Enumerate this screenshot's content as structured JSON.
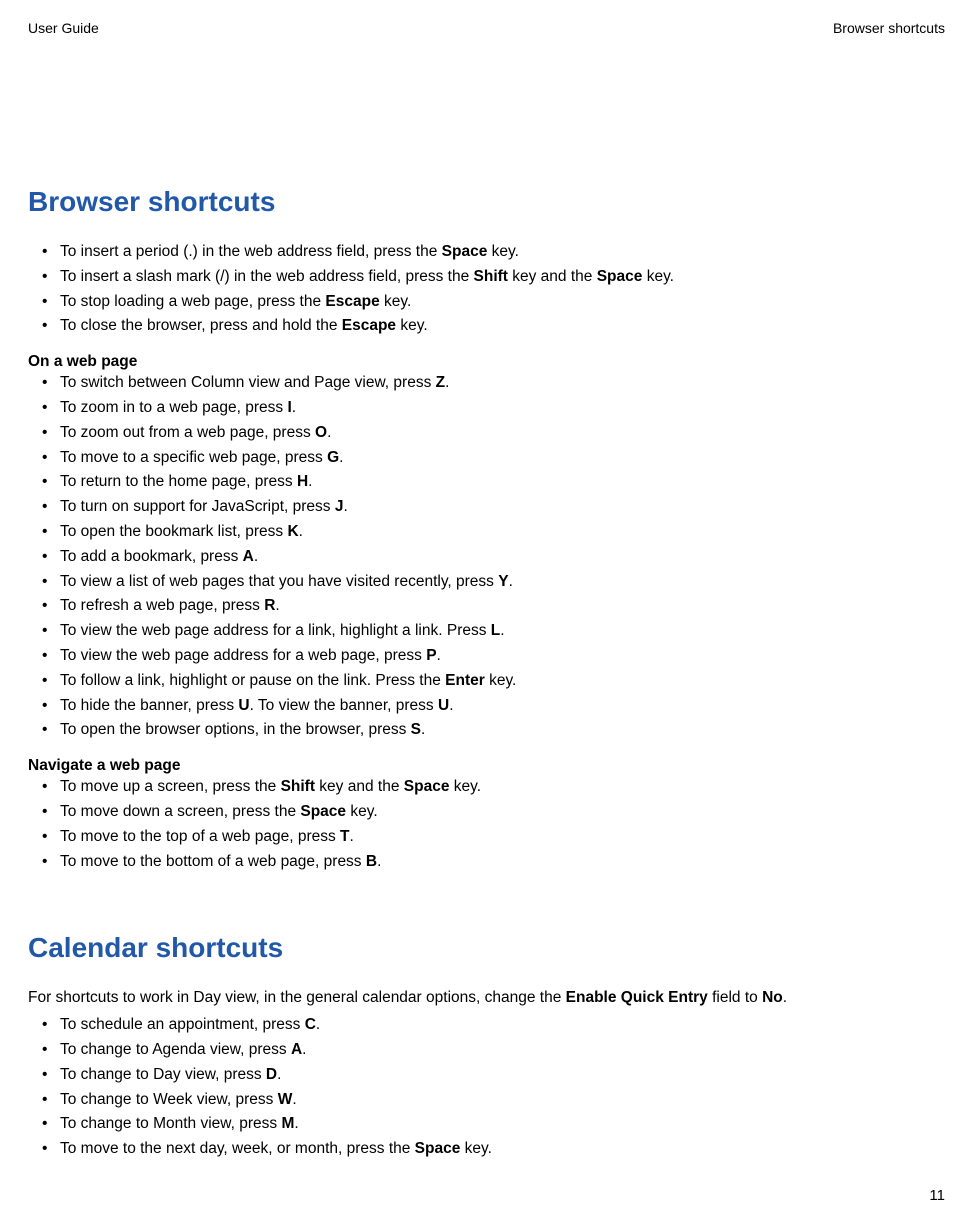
{
  "header": {
    "left": "User Guide",
    "right": "Browser shortcuts"
  },
  "page_number": "11",
  "sections": {
    "browser": {
      "title": "Browser shortcuts",
      "general": [
        [
          [
            "To insert a period (.) in the web address field, press the "
          ],
          [
            "b",
            "Space"
          ],
          [
            " key."
          ]
        ],
        [
          [
            "To insert a slash mark (/) in the web address field, press the "
          ],
          [
            "b",
            "Shift"
          ],
          [
            " key and the "
          ],
          [
            "b",
            "Space"
          ],
          [
            " key."
          ]
        ],
        [
          [
            "To stop loading a web page, press the "
          ],
          [
            "b",
            "Escape"
          ],
          [
            " key."
          ]
        ],
        [
          [
            "To close the browser, press and hold the "
          ],
          [
            "b",
            "Escape"
          ],
          [
            " key."
          ]
        ]
      ],
      "on_page_label": "On a web page",
      "on_page": [
        [
          [
            "To switch between Column view and Page view, press "
          ],
          [
            "b",
            "Z"
          ],
          [
            "."
          ]
        ],
        [
          [
            "To zoom in to a web page, press "
          ],
          [
            "b",
            "I"
          ],
          [
            "."
          ]
        ],
        [
          [
            "To zoom out from a web page, press "
          ],
          [
            "b",
            "O"
          ],
          [
            "."
          ]
        ],
        [
          [
            "To move to a specific web page, press "
          ],
          [
            "b",
            "G"
          ],
          [
            "."
          ]
        ],
        [
          [
            "To return to the home page, press "
          ],
          [
            "b",
            "H"
          ],
          [
            "."
          ]
        ],
        [
          [
            "To turn on support for JavaScript, press "
          ],
          [
            "b",
            "J"
          ],
          [
            "."
          ]
        ],
        [
          [
            "To open the bookmark list, press "
          ],
          [
            "b",
            "K"
          ],
          [
            "."
          ]
        ],
        [
          [
            "To add a bookmark, press "
          ],
          [
            "b",
            "A"
          ],
          [
            "."
          ]
        ],
        [
          [
            "To view a list of web pages that you have visited recently, press "
          ],
          [
            "b",
            "Y"
          ],
          [
            "."
          ]
        ],
        [
          [
            "To refresh a web page, press "
          ],
          [
            "b",
            "R"
          ],
          [
            "."
          ]
        ],
        [
          [
            "To view the web page address for a link, highlight a link. Press "
          ],
          [
            "b",
            "L"
          ],
          [
            "."
          ]
        ],
        [
          [
            "To view the web page address for a web page, press "
          ],
          [
            "b",
            "P"
          ],
          [
            "."
          ]
        ],
        [
          [
            "To follow a link, highlight or pause on the link. Press the "
          ],
          [
            "b",
            "Enter"
          ],
          [
            " key."
          ]
        ],
        [
          [
            "To hide the banner, press "
          ],
          [
            "b",
            "U"
          ],
          [
            ". To view the banner, press "
          ],
          [
            "b",
            "U"
          ],
          [
            "."
          ]
        ],
        [
          [
            "To open the browser options, in the browser, press "
          ],
          [
            "b",
            "S"
          ],
          [
            "."
          ]
        ]
      ],
      "nav_label": "Navigate a web page",
      "nav": [
        [
          [
            "To move up a screen, press the "
          ],
          [
            "b",
            "Shift"
          ],
          [
            " key and the "
          ],
          [
            "b",
            "Space"
          ],
          [
            " key."
          ]
        ],
        [
          [
            "To move down a screen, press the "
          ],
          [
            "b",
            "Space"
          ],
          [
            " key."
          ]
        ],
        [
          [
            "To move to the top of a web page, press "
          ],
          [
            "b",
            "T"
          ],
          [
            "."
          ]
        ],
        [
          [
            "To move to the bottom of a web page, press "
          ],
          [
            "b",
            "B"
          ],
          [
            "."
          ]
        ]
      ]
    },
    "calendar": {
      "title": "Calendar shortcuts",
      "intro": [
        [
          "For shortcuts to work in Day view, in the general calendar options, change the "
        ],
        [
          "b",
          "Enable Quick Entry"
        ],
        [
          " field to "
        ],
        [
          "b",
          "No"
        ],
        [
          "."
        ]
      ],
      "items": [
        [
          [
            "To schedule an appointment, press "
          ],
          [
            "b",
            "C"
          ],
          [
            "."
          ]
        ],
        [
          [
            "To change to Agenda view, press "
          ],
          [
            "b",
            "A"
          ],
          [
            "."
          ]
        ],
        [
          [
            "To change to Day view, press "
          ],
          [
            "b",
            "D"
          ],
          [
            "."
          ]
        ],
        [
          [
            "To change to Week view, press "
          ],
          [
            "b",
            "W"
          ],
          [
            "."
          ]
        ],
        [
          [
            "To change to Month view, press "
          ],
          [
            "b",
            "M"
          ],
          [
            "."
          ]
        ],
        [
          [
            "To move to the next day, week, or month, press the "
          ],
          [
            "b",
            "Space"
          ],
          [
            " key."
          ]
        ]
      ]
    }
  }
}
